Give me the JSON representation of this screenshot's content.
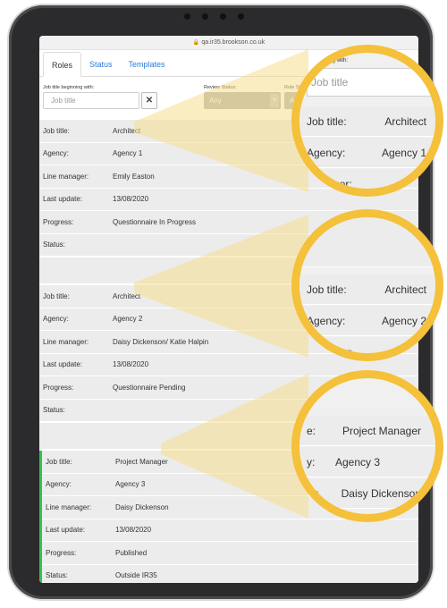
{
  "browser": {
    "url": "qa.ir35.brookson.co.uk"
  },
  "tabs": [
    {
      "label": "Roles",
      "active": true
    },
    {
      "label": "Status",
      "active": false
    },
    {
      "label": "Templates",
      "active": false
    }
  ],
  "filters": {
    "job_title_label": "Job title beginning with:",
    "job_title_placeholder": "Job title",
    "clear_symbol": "✕",
    "review_status_label": "Review Status:",
    "review_status_value": "Any",
    "role_status_label": "Role Status:",
    "role_status_value": "Any"
  },
  "field_labels": {
    "job_title": "Job title:",
    "agency": "Agency:",
    "line_manager": "Line manager:",
    "last_update": "Last update:",
    "progress": "Progress:",
    "status": "Status:"
  },
  "roles": [
    {
      "job_title": "Architect",
      "agency": "Agency 1",
      "line_manager": "Emily Easton",
      "last_update": "13/08/2020",
      "progress": "Questionnaire In Progress",
      "status": ""
    },
    {
      "job_title": "Architect",
      "agency": "Agency 2",
      "line_manager": "Daisy Dickenson/ Katie Halpin",
      "last_update": "13/08/2020",
      "progress": "Questionnaire Pending",
      "status": ""
    },
    {
      "job_title": "Project Manager",
      "agency": "Agency 3",
      "line_manager": "Daisy Dickenson",
      "last_update": "13/08/2020",
      "progress": "Published",
      "status": "Outside IR35"
    }
  ],
  "magnifiers": [
    {
      "caption": "beginning with:",
      "placeholder": "Job title",
      "rows": [
        {
          "label": "Job title:",
          "value": "Architect"
        },
        {
          "label": "Agency:",
          "value": "Agency 1"
        },
        {
          "label": "manager:",
          "value": "Emil"
        }
      ]
    },
    {
      "rows": [
        {
          "label": "Job title:",
          "value": "Architect"
        },
        {
          "label": "Agency:",
          "value": "Agency 2"
        },
        {
          "label": "manager:",
          "value": "Daisy"
        }
      ]
    },
    {
      "rows": [
        {
          "label": "e:",
          "value": "Project Manager"
        },
        {
          "label": "y:",
          "value": "Agency 3"
        },
        {
          "label": "ag",
          "value": "Daisy Dickenson"
        }
      ]
    }
  ],
  "colors": {
    "accent_link": "#2b7cd6",
    "magnifier_ring": "#f5c03a",
    "published_bar": "#33c24d",
    "select_bg": "#b0b0b0"
  }
}
